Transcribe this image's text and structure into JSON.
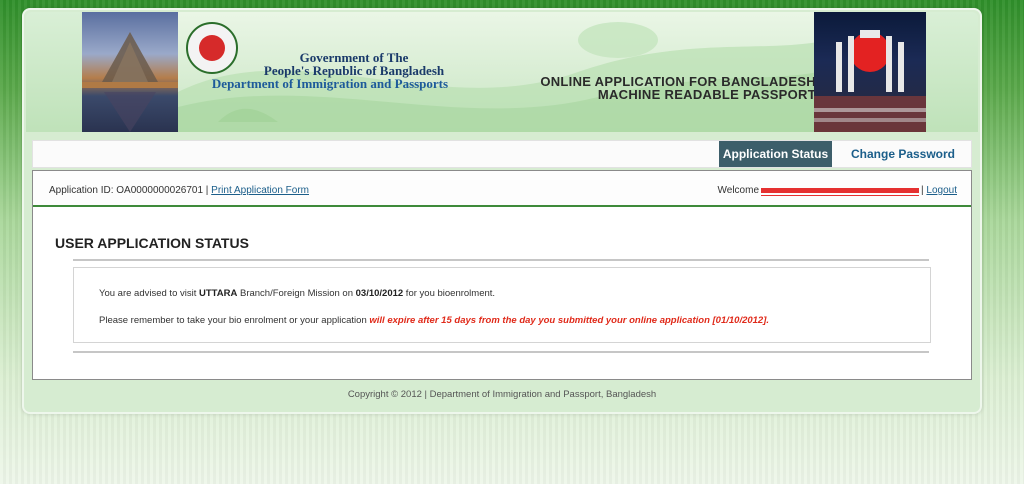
{
  "header": {
    "gov_line1": "Government of The",
    "gov_line2": "People's Republic of Bangladesh",
    "gov_line3": "Department of Immigration and Passports",
    "online_line1": "ONLINE APPLICATION FOR BANGLADESH",
    "online_line2": "MACHINE READABLE PASSPORT"
  },
  "nav": {
    "status_label": "Application Status",
    "password_label": "Change Password"
  },
  "userbar": {
    "app_id_label": "Application ID: OA0000000026701 |",
    "print_link": "Print Application Form",
    "welcome_label": "Welcome",
    "separator": "|",
    "logout_link": "Logout"
  },
  "main": {
    "title": "USER APPLICATION STATUS",
    "msg1_pre": "You are advised to visit ",
    "msg1_branch": "UTTARA",
    "msg1_mid": " Branch/Foreign Mission on ",
    "msg1_date": "03/10/2012",
    "msg1_post": " for you bioenrolment.",
    "msg2_pre": "Please remember to take your bio enrolment or your application ",
    "msg2_warning": "will expire after 15 days from the day you submitted your online application [01/10/2012]."
  },
  "footer": {
    "copyright": "Copyright © 2012 | Department of Immigration and Passport, Bangladesh"
  },
  "colors": {
    "nav_active_bg": "#3d5e6a",
    "link": "#1b5e8a",
    "warning": "#e02a1a",
    "accent_green": "#3e8a3a"
  }
}
